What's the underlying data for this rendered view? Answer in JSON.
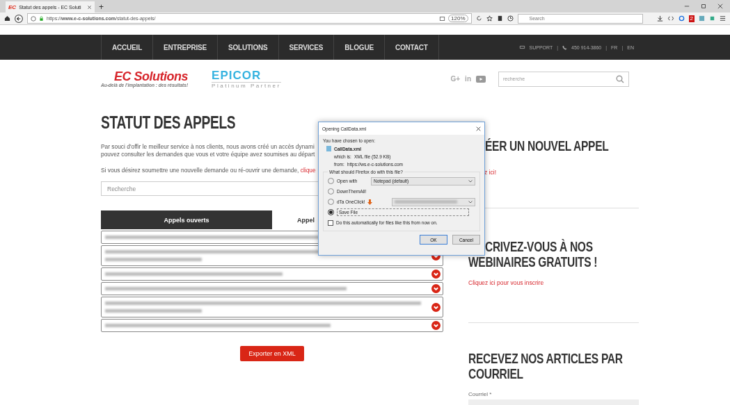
{
  "browser": {
    "tab": {
      "favicon": "EC",
      "title": "Statut des appels - EC Soluti",
      "selected": true
    },
    "new_tab": "+",
    "url": "https://**www.e-c-solutions.com**/statut-des-appels/",
    "zoom": "120%",
    "search": {
      "placeholder": "Search"
    },
    "addon_badge": "2"
  },
  "nav": {
    "items": [
      {
        "label": "ACCUEIL"
      },
      {
        "label": "ENTREPRISE"
      },
      {
        "label": "SOLUTIONS"
      },
      {
        "label": "SERVICES"
      },
      {
        "label": "BLOGUE"
      },
      {
        "label": "CONTACT"
      }
    ],
    "support": "SUPPORT",
    "separator": "|",
    "phone": "450 914-3860",
    "languages": [
      {
        "label": "FR"
      },
      {
        "label": "EN"
      }
    ]
  },
  "header": {
    "logo": {
      "name": "EC Solutions",
      "tagline": "Au-delà de l'implantation : des résultats!"
    },
    "partner": {
      "name": "EPICOR",
      "level": "Platinum Partner"
    },
    "social": [
      {
        "kind": "gplus",
        "label": "G+"
      },
      {
        "kind": "linkedin",
        "label": "in"
      },
      {
        "kind": "youtube"
      }
    ],
    "search": {
      "placeholder": "recherche"
    }
  },
  "main": {
    "title": "STATUT DES APPELS",
    "intro": [
      "Par souci d'offir le meilleur service à nos clients, nous avons créé un accès dynami",
      "pouvez consulter les demandes que vous et votre équipe avez soumises au départ"
    ],
    "submit_text": "Si vous désirez soumettre une nouvelle demande ou ré-ouvrir une demande, ",
    "submit_link": "clique",
    "search": {
      "placeholder": "Recherche"
    },
    "tabs": [
      {
        "label": "Appels ouverts",
        "selected": true
      },
      {
        "label": "Appel",
        "selected": false
      }
    ],
    "rows": [
      {
        "kind": "single"
      },
      {
        "kind": "double"
      },
      {
        "kind": "single"
      },
      {
        "kind": "single"
      },
      {
        "kind": "double"
      },
      {
        "kind": "single"
      }
    ],
    "export_button": "Exporter en XML"
  },
  "sidebar": {
    "sections": [
      {
        "title_lines": [
          "ÉER UN NOUVEL APPEL"
        ],
        "link": "z ici!",
        "covered": true
      },
      {
        "title_lines": [
          "CRIVEZ-VOUS À NOS",
          "WEBINAIRES GRATUITS !"
        ],
        "link": "Cliquez ici pour vous inscrire",
        "covered": true
      },
      {
        "title_lines": [
          "RECEVEZ NOS ARTICLES PAR",
          "COURRIEL"
        ],
        "field_label": "Courriel *"
      }
    ]
  },
  "dialog": {
    "title": "Opening CallData.xml",
    "intro": "You have chosen to open:",
    "file": "CallData.xml",
    "type_label": "which is:",
    "type": "XML file (52.9 KB)",
    "from_label": "from:",
    "from": "https://ws.e-c-solutions.com",
    "question": "What should Firefox do with this file?",
    "options": [
      {
        "kind": "app",
        "label": "Open with",
        "select": "Notepad (default)",
        "selected": false
      },
      {
        "kind": "plain",
        "label": "DownThemAll!",
        "selected": false
      },
      {
        "kind": "folder",
        "label": "dTa OneClick!",
        "selected": false
      },
      {
        "kind": "plain",
        "label": "Save File",
        "selected": true
      }
    ],
    "remember": {
      "label": "Do this automatically for files like this from now on.",
      "checked": false
    },
    "buttons": [
      {
        "label": "OK",
        "default": true
      },
      {
        "label": "Cancel",
        "default": false
      }
    ]
  }
}
